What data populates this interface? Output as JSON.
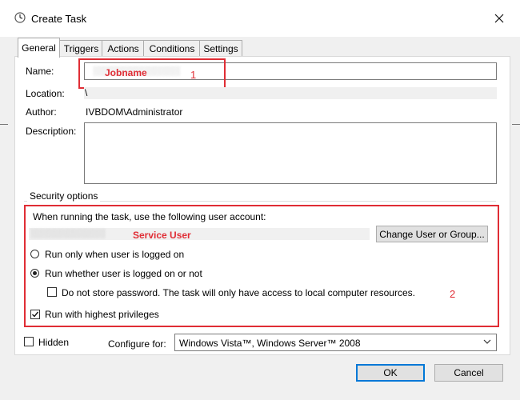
{
  "window": {
    "title": "Create Task",
    "close_icon": "close-icon"
  },
  "tabs": [
    {
      "label": "General",
      "active": true
    },
    {
      "label": "Triggers"
    },
    {
      "label": "Actions"
    },
    {
      "label": "Conditions"
    },
    {
      "label": "Settings"
    }
  ],
  "general": {
    "name_label": "Name:",
    "name_value_obscured": "░░░░░░░░░░░░░░",
    "name_annotation": "Jobname",
    "name_annotation_number": "1",
    "location_label": "Location:",
    "location_value": "\\",
    "author_label": "Author:",
    "author_value": "IVBDOM\\Administrator",
    "description_label": "Description:",
    "description_value": ""
  },
  "security": {
    "group_label": "Security options",
    "run_as_text": "When running the task, use the following user account:",
    "user_value_obscured": "░░░░░░░░░░░░",
    "user_annotation": "Service User",
    "change_button_label": "Change User or Group...",
    "radio_logged_on": {
      "label": "Run only when user is logged on",
      "selected": false
    },
    "radio_whether": {
      "label": "Run whether user is logged on or not",
      "selected": true
    },
    "no_store_password": {
      "label": "Do not store password.  The task will only have access to local computer resources.",
      "checked": false
    },
    "highest_privileges": {
      "label": "Run with highest privileges",
      "checked": true
    },
    "annotation_number": "2"
  },
  "footer": {
    "hidden": {
      "label": "Hidden",
      "checked": false
    },
    "configure_label": "Configure for:",
    "configure_value": "Windows Vista™, Windows Server™ 2008",
    "ok_label": "OK",
    "cancel_label": "Cancel"
  },
  "colors": {
    "annotation_red": "#e02d35",
    "accent_blue": "#0078d7"
  }
}
